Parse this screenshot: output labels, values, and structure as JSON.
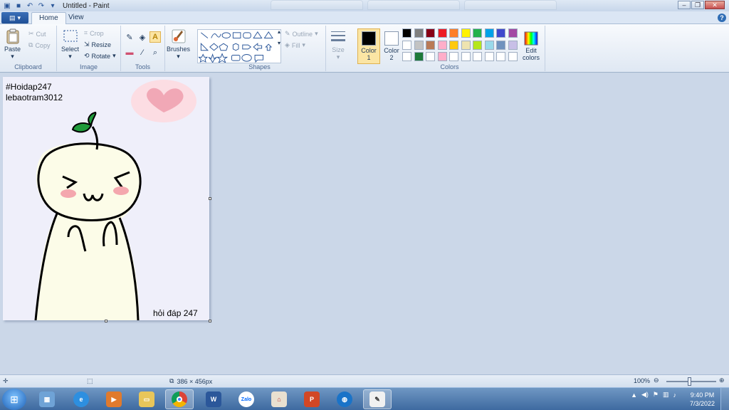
{
  "window": {
    "title": "Untitled - Paint"
  },
  "tabs": [
    {
      "label": "Home"
    },
    {
      "label": "View"
    }
  ],
  "ribbon": {
    "clipboard": {
      "label": "Clipboard",
      "paste": "Paste",
      "cut": "Cut",
      "copy": "Copy"
    },
    "image": {
      "label": "Image",
      "select": "Select",
      "crop": "Crop",
      "resize": "Resize",
      "rotate": "Rotate"
    },
    "tools": {
      "label": "Tools"
    },
    "brushes": {
      "label": "Brushes"
    },
    "shapes": {
      "label": "Shapes",
      "outline": "Outline",
      "fill": "Fill"
    },
    "size": {
      "label": "Size"
    },
    "colors": {
      "label": "Colors",
      "color1": "Color 1",
      "color1_num": "1",
      "color1_word": "Color",
      "color2_word": "Color",
      "color2_num": "2",
      "edit_colors_1": "Edit",
      "edit_colors_2": "colors",
      "color1_value": "#000000",
      "color2_value": "#ffffff",
      "palette": [
        "#000000",
        "#7f7f7f",
        "#880015",
        "#ed1c24",
        "#ff7f27",
        "#fff200",
        "#22b14c",
        "#00a2e8",
        "#3f48cc",
        "#a349a4",
        "#ffffff",
        "#c3c3c3",
        "#b97a57",
        "#ffaec9",
        "#ffc90e",
        "#efe4b0",
        "#b5e61d",
        "#99d9ea",
        "#7092be",
        "#c8bfe7",
        "#ffffff",
        "#1e7a3a",
        "#ffffff",
        "#ffaec9",
        "#ffffff",
        "#ffffff",
        "#ffffff",
        "#ffffff",
        "#ffffff",
        "#ffffff"
      ]
    }
  },
  "canvas": {
    "text_line1": "#Hoidap247",
    "text_line2": "lebaotram3012",
    "text_bottom": "hỏi đáp 247"
  },
  "status": {
    "dimensions": "386 × 456px",
    "zoom": "100%"
  },
  "taskbar": {
    "apps": [
      "calculator-icon",
      "ie-icon",
      "media-icon",
      "folder-icon",
      "chrome-icon",
      "word-icon",
      "zalo-icon",
      "network-icon",
      "powerpoint-icon",
      "browser-icon",
      "paint-icon"
    ],
    "word_letter": "W",
    "zalo_label": "Zalo",
    "powerpoint_letter": "P",
    "time": "9:40 PM",
    "date": "7/3/2022"
  }
}
